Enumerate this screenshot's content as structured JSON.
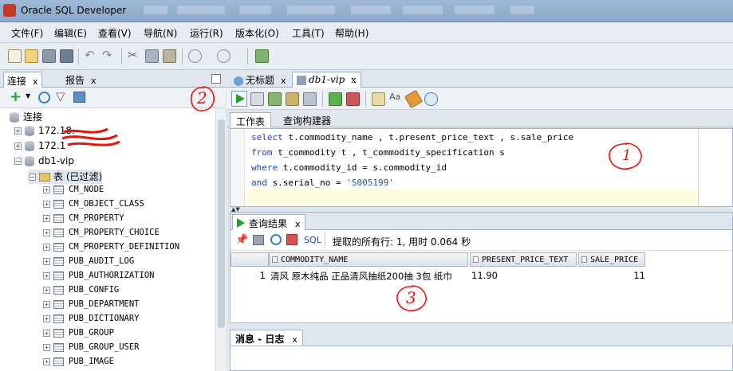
{
  "window": {
    "title": "Oracle SQL Developer"
  },
  "menu": [
    "文件(F)",
    "编辑(E)",
    "查看(V)",
    "导航(N)",
    "运行(R)",
    "版本化(O)",
    "工具(T)",
    "帮助(H)"
  ],
  "left_panel": {
    "tabs": [
      {
        "label": "连接"
      },
      {
        "label": "报告"
      }
    ],
    "tree": {
      "root": "连接",
      "connections": [
        "172.18.",
        "172.1"
      ],
      "active_connection": "db1-vip",
      "tables_folder": "表 (已过滤)",
      "tables": [
        "CM_NODE",
        "CM_OBJECT_CLASS",
        "CM_PROPERTY",
        "CM_PROPERTY_CHOICE",
        "CM_PROPERTY_DEFINITION",
        "PUB_AUDIT_LOG",
        "PUB_AUTHORIZATION",
        "PUB_CONFIG",
        "PUB_DEPARTMENT",
        "PUB_DICTIONARY",
        "PUB_GROUP",
        "PUB_GROUP_USER",
        "PUB_IMAGE"
      ]
    }
  },
  "editor_tabs": [
    {
      "label": "无标题"
    },
    {
      "label": "db1-vip"
    }
  ],
  "worksheet_tabs": [
    {
      "label": "工作表"
    },
    {
      "label": "查询构建器"
    }
  ],
  "sql": {
    "line1_kw": "select",
    "line1_rest": " t.commodity_name , t.present_price_text , s.sale_price",
    "line2_kw": "from",
    "line2_rest": " t_commodity t , t_commodity_specification s",
    "line3_kw": "where",
    "line3_rest": " t.commodity_id = s.commodity_id",
    "line4_kw": "and",
    "line4_mid": " s.serial_no = ",
    "line4_str": "'S005199'"
  },
  "results": {
    "tab_label": "查询结果",
    "sql_button": "SQL",
    "status": "提取的所有行: 1, 用时 0.064 秒",
    "columns": [
      "COMMODITY_NAME",
      "PRESENT_PRICE_TEXT",
      "SALE_PRICE"
    ],
    "rows": [
      {
        "num": "1",
        "commodity_name": "清风 原木纯品 正品清风抽纸200抽 3包 纸巾",
        "present_price_text": "11.90",
        "sale_price": "11"
      }
    ]
  },
  "log": {
    "tab_label": "消息 - 日志"
  },
  "annotations": {
    "a1": "1",
    "a2": "2",
    "a3": "3"
  },
  "colors": {
    "keyword": "#1e3fc4",
    "annotation": "#e8140c",
    "run_green": "#1fa12a"
  }
}
